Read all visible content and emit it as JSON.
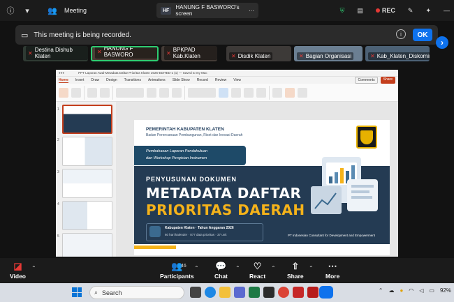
{
  "topbar": {
    "meeting_label": "Meeting",
    "share_badge": "HF",
    "share_title": "HANUNG F BASWORO's screen",
    "rec_label": "REC"
  },
  "banner": {
    "text": "This meeting is being recorded.",
    "info": "i",
    "ok_label": "OK"
  },
  "participants": [
    {
      "name": "Destina Dishub Klaten",
      "active": false
    },
    {
      "name": "HANUNG F BASWORO",
      "active": true
    },
    {
      "name": "BPKPAD Kab.Klaten",
      "active": false
    },
    {
      "name": "Disdik Klaten",
      "active": false
    },
    {
      "name": "Bagian Organisasi",
      "active": false
    },
    {
      "name": "Kab_Klaten_Diskominfo",
      "active": false
    }
  ],
  "ppt": {
    "window_title": "PPT Laporan Awal-Metadata Daftar Prioritas Klaten 2026-EDITED-1 (1)  —  Saved to my Mac",
    "tabs": [
      "Home",
      "Insert",
      "Draw",
      "Design",
      "Transitions",
      "Animations",
      "Slide Show",
      "Record",
      "Review",
      "View"
    ],
    "active_tab": "Home",
    "comments_label": "Comments",
    "share_label": "Share",
    "thumb_numbers": [
      "1",
      "2",
      "3",
      "4",
      "5"
    ]
  },
  "slide": {
    "gov_title": "PEMERINTAH KABUPATEN KLATEN",
    "gov_sub": "Badan Perencanaan Pembangunan, Riset dan Inovasi Daerah",
    "band_line1": "Pembahasan Laporan Pendahuluan",
    "band_line2": "dan Workshop Pengisian Instrumen",
    "pre_title": "PENYUSUNAN DOKUMEN",
    "title1": "METADATA DAFTAR",
    "title2": "PRIORITAS DAERAH",
    "info1": "Kabupaten Klaten  ·  Tahun Anggaran 2026",
    "info2": "60 hari kalender  ·  877 data prioritas  ·  37 unit",
    "consultant": "PT Indonesian Consultant for Development and Empowerment"
  },
  "toolbar": {
    "video": "Video",
    "participants": "Participants",
    "participants_count": "46",
    "chat": "Chat",
    "react": "React",
    "share": "Share",
    "more": "More"
  },
  "taskbar": {
    "search_placeholder": "Search",
    "battery": "92%"
  },
  "colors": {
    "zoom_blue": "#0e72ed",
    "rec_red": "#e53935",
    "ppt_accent": "#c43e1c",
    "slide_navy": "#243b53",
    "slide_gold": "#f5b31a"
  }
}
